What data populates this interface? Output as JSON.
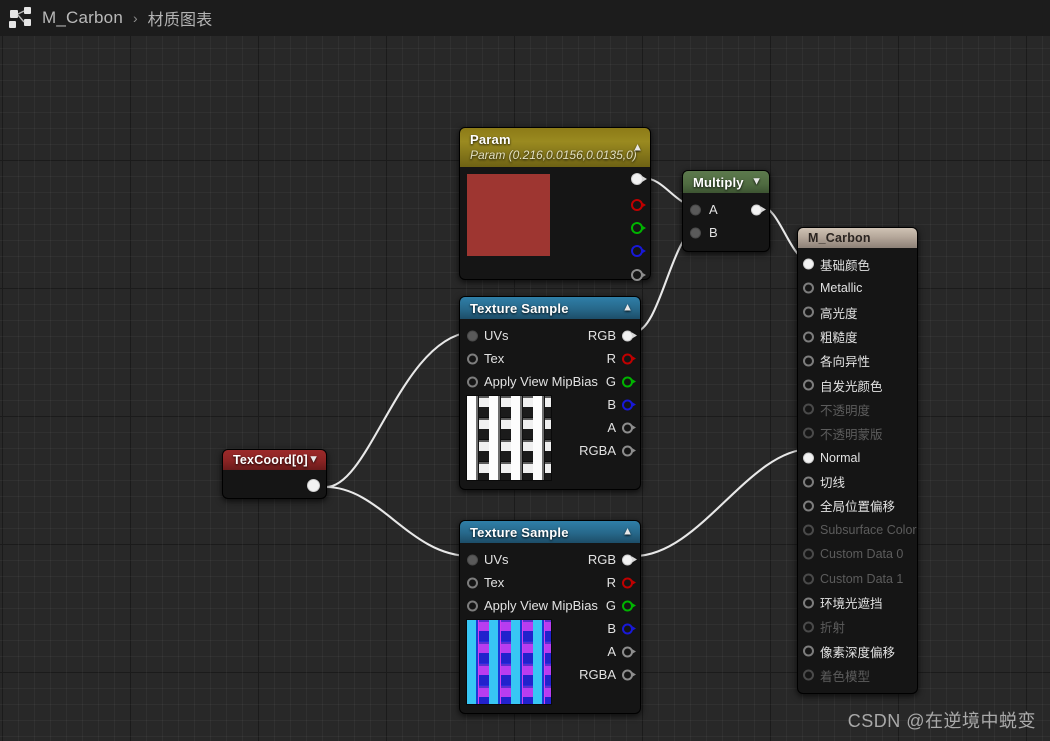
{
  "titlebar": {
    "icon": "graph-node-icon",
    "breadcrumb_root": "M_Carbon",
    "breadcrumb_sep": "›",
    "breadcrumb_current": "材质图表"
  },
  "watermark": "CSDN @在逆境中蜕变",
  "colors": {
    "canvas_bg": "#282828",
    "titlebar_bg": "#1c1c1c",
    "node_bg": "#151515",
    "param_header": "#8d7b17",
    "multiply_header": "#4f6b41",
    "texture_header": "#27688a",
    "texcoord_header": "#8a2424",
    "result_header": "#b5a79a",
    "param_swatch": "#9e3631",
    "wire": "#e8e8e8",
    "pin_red": "#c00000",
    "pin_green": "#00b400",
    "pin_blue": "#1818d8",
    "pin_alpha": "#8d8d8d"
  },
  "nodes": {
    "param": {
      "title": "Param",
      "subtitle": "Param (0.216,0.0156,0.0135,0)",
      "collapse_icon": "chevron-up-icon",
      "swatch_color": "#9e3631",
      "outputs": [
        {
          "name": "rgba-out",
          "kind": "filled"
        },
        {
          "name": "r-out",
          "kind": "r"
        },
        {
          "name": "g-out",
          "kind": "g"
        },
        {
          "name": "b-out",
          "kind": "b"
        },
        {
          "name": "a-out",
          "kind": "a"
        }
      ]
    },
    "multiply": {
      "title": "Multiply",
      "collapse_icon": "chevron-down-icon",
      "inputs": [
        {
          "label": "A",
          "kind": "grey"
        },
        {
          "label": "B",
          "kind": "grey"
        }
      ],
      "output": {
        "label": "",
        "kind": "filled"
      }
    },
    "texture_sample_1": {
      "title": "Texture Sample",
      "collapse_icon": "chevron-up-icon",
      "inputs": [
        {
          "label": "UVs",
          "kind": "grey"
        },
        {
          "label": "Tex",
          "kind": "hollow"
        },
        {
          "label": "Apply View MipBias",
          "kind": "hollow"
        }
      ],
      "outputs": [
        {
          "label": "RGB",
          "kind": "filled"
        },
        {
          "label": "R",
          "kind": "r"
        },
        {
          "label": "G",
          "kind": "g"
        },
        {
          "label": "B",
          "kind": "b"
        },
        {
          "label": "A",
          "kind": "a"
        },
        {
          "label": "RGBA",
          "kind": "a"
        }
      ],
      "preview": "carbon-weave-grayscale"
    },
    "texture_sample_2": {
      "title": "Texture Sample",
      "collapse_icon": "chevron-up-icon",
      "inputs": [
        {
          "label": "UVs",
          "kind": "grey"
        },
        {
          "label": "Tex",
          "kind": "hollow"
        },
        {
          "label": "Apply View MipBias",
          "kind": "hollow"
        }
      ],
      "outputs": [
        {
          "label": "RGB",
          "kind": "filled"
        },
        {
          "label": "R",
          "kind": "r"
        },
        {
          "label": "G",
          "kind": "g"
        },
        {
          "label": "B",
          "kind": "b"
        },
        {
          "label": "A",
          "kind": "a"
        },
        {
          "label": "RGBA",
          "kind": "a"
        }
      ],
      "preview": "carbon-weave-normalmap"
    },
    "texcoord": {
      "title": "TexCoord[0]",
      "collapse_icon": "chevron-down-icon",
      "output": {
        "kind": "filled"
      }
    },
    "result": {
      "title": "M_Carbon",
      "pins": [
        {
          "label": "基础颜色",
          "connected": true,
          "enabled": true
        },
        {
          "label": "Metallic",
          "connected": false,
          "enabled": true
        },
        {
          "label": "高光度",
          "connected": false,
          "enabled": true
        },
        {
          "label": "粗糙度",
          "connected": false,
          "enabled": true
        },
        {
          "label": "各向异性",
          "connected": false,
          "enabled": true
        },
        {
          "label": "自发光颜色",
          "connected": false,
          "enabled": true
        },
        {
          "label": "不透明度",
          "connected": false,
          "enabled": false
        },
        {
          "label": "不透明蒙版",
          "connected": false,
          "enabled": false
        },
        {
          "label": "Normal",
          "connected": true,
          "enabled": true
        },
        {
          "label": "切线",
          "connected": false,
          "enabled": true
        },
        {
          "label": "全局位置偏移",
          "connected": false,
          "enabled": true
        },
        {
          "label": "Subsurface Color",
          "connected": false,
          "enabled": false
        },
        {
          "label": "Custom Data 0",
          "connected": false,
          "enabled": false
        },
        {
          "label": "Custom Data 1",
          "connected": false,
          "enabled": false
        },
        {
          "label": "环境光遮挡",
          "connected": false,
          "enabled": true
        },
        {
          "label": "折射",
          "connected": false,
          "enabled": false
        },
        {
          "label": "像素深度偏移",
          "connected": false,
          "enabled": true
        },
        {
          "label": "着色模型",
          "connected": false,
          "enabled": false
        }
      ]
    }
  }
}
